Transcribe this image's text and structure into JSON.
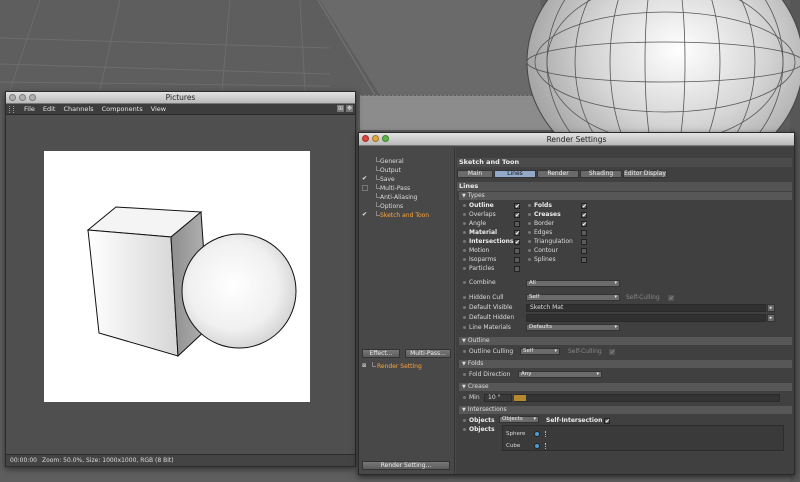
{
  "pictures": {
    "title": "Pictures",
    "menu": [
      "File",
      "Edit",
      "Channels",
      "Components",
      "View"
    ],
    "status": {
      "time": "00:00:00",
      "info": "Zoom: 50.0%, Size: 1000x1000, RGB (8 Bit)"
    }
  },
  "render_settings": {
    "title": "Render Settings",
    "nav": [
      {
        "label": "General",
        "checked": false
      },
      {
        "label": "Output",
        "checked": false
      },
      {
        "label": "Save",
        "checked": true
      },
      {
        "label": "Multi-Pass",
        "checked": false
      },
      {
        "label": "Anti-Aliasing",
        "checked": false
      },
      {
        "label": "Options",
        "checked": false
      },
      {
        "label": "Sketch and Toon",
        "checked": true,
        "active": true
      }
    ],
    "effect_button": "Effect...",
    "multipass_button": "Multi-Pass...",
    "render_setting_item": "Render Setting",
    "render_setting_button": "Render Setting...",
    "panel_title": "Sketch and Toon",
    "tabs": [
      "Main",
      "Lines",
      "Render",
      "Shading",
      "Editor Display"
    ],
    "active_tab": "Lines",
    "section_title": "Lines",
    "types_header": "Types",
    "types_left": [
      {
        "label": "Outline",
        "checked": true,
        "bold": true
      },
      {
        "label": "Overlaps",
        "checked": true,
        "bold": false
      },
      {
        "label": "Angle",
        "checked": false,
        "bold": false
      },
      {
        "label": "Material",
        "checked": true,
        "bold": true
      },
      {
        "label": "Intersections",
        "checked": true,
        "bold": true
      },
      {
        "label": "Motion",
        "checked": false,
        "bold": false
      },
      {
        "label": "Isoparms",
        "checked": false,
        "bold": false
      },
      {
        "label": "Particles",
        "checked": false,
        "bold": false
      }
    ],
    "types_right": [
      {
        "label": "Folds",
        "checked": true,
        "bold": true
      },
      {
        "label": "Creases",
        "checked": true,
        "bold": true
      },
      {
        "label": "Border",
        "checked": true,
        "bold": false
      },
      {
        "label": "Edges",
        "checked": false,
        "bold": false
      },
      {
        "label": "Triangulation",
        "checked": false,
        "bold": false
      },
      {
        "label": "Contour",
        "checked": false,
        "bold": false
      },
      {
        "label": "Splines",
        "checked": false,
        "bold": false
      }
    ],
    "combine_label": "Combine",
    "combine_value": "All",
    "hidden_cull_label": "Hidden Cull",
    "hidden_cull_value": "Self",
    "self_culling_label": "Self-Culling",
    "default_visible_label": "Default Visible",
    "default_visible_value": "Sketch Mat",
    "default_hidden_label": "Default Hidden",
    "line_materials_label": "Line Materials",
    "line_materials_value": "Defaults",
    "outline_header": "Outline",
    "outline_culling_label": "Outline Culling",
    "outline_culling_value": "Self",
    "outline_self_culling_label": "Self-Culling",
    "folds_header": "Folds",
    "fold_direction_label": "Fold Direction",
    "fold_direction_value": "Any",
    "crease_header": "Crease",
    "min_label": "Min",
    "min_value": "10 °",
    "intersections_header": "Intersections",
    "objects_label": "Objects",
    "objects_value": "Objects",
    "self_intersection_label": "Self-Intersection",
    "objects_list_label": "Objects",
    "objects_list": [
      "Sphere",
      "Cube"
    ]
  },
  "colors": {
    "accent_orange": "#ffa43a",
    "active_tab": "#93a9c9"
  }
}
